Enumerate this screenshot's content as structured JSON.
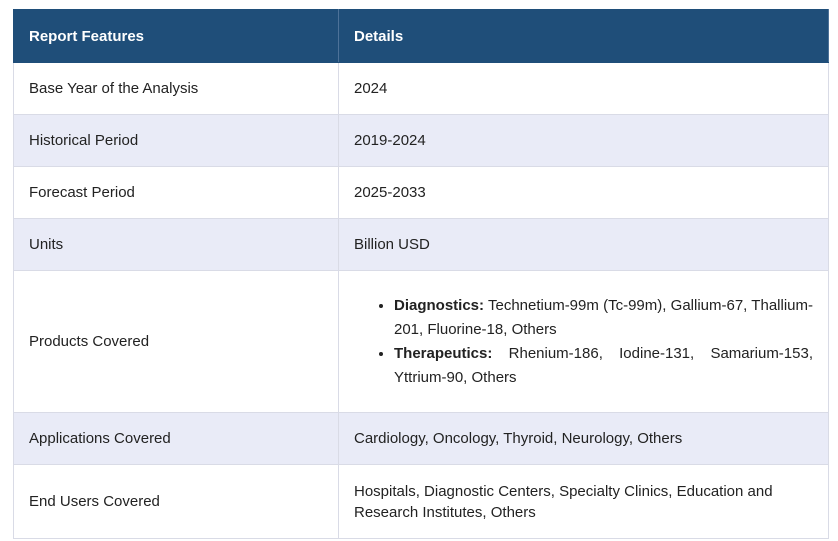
{
  "header": {
    "col1": "Report Features",
    "col2": "Details"
  },
  "rows": [
    {
      "feature": "Base Year of the Analysis",
      "detail": "2024"
    },
    {
      "feature": "Historical Period",
      "detail": "2019-2024"
    },
    {
      "feature": "Forecast Period",
      "detail": "2025-2033"
    },
    {
      "feature": "Units",
      "detail": "Billion USD"
    },
    {
      "feature": "Products Covered",
      "items": [
        {
          "label": "Diagnostics:",
          "text": "Technetium-99m (Tc-99m), Gallium-67, Thallium-201, Fluorine-18, Others"
        },
        {
          "label": "Therapeutics:",
          "text": "Rhenium-186, Iodine-131, Samarium-153, Yttrium-90, Others"
        }
      ]
    },
    {
      "feature": "Applications Covered",
      "detail": "Cardiology, Oncology, Thyroid, Neurology, Others"
    },
    {
      "feature": "End Users Covered",
      "detail": "Hospitals, Diagnostic Centers, Specialty Clinics, Education and Research Institutes, Others"
    }
  ]
}
